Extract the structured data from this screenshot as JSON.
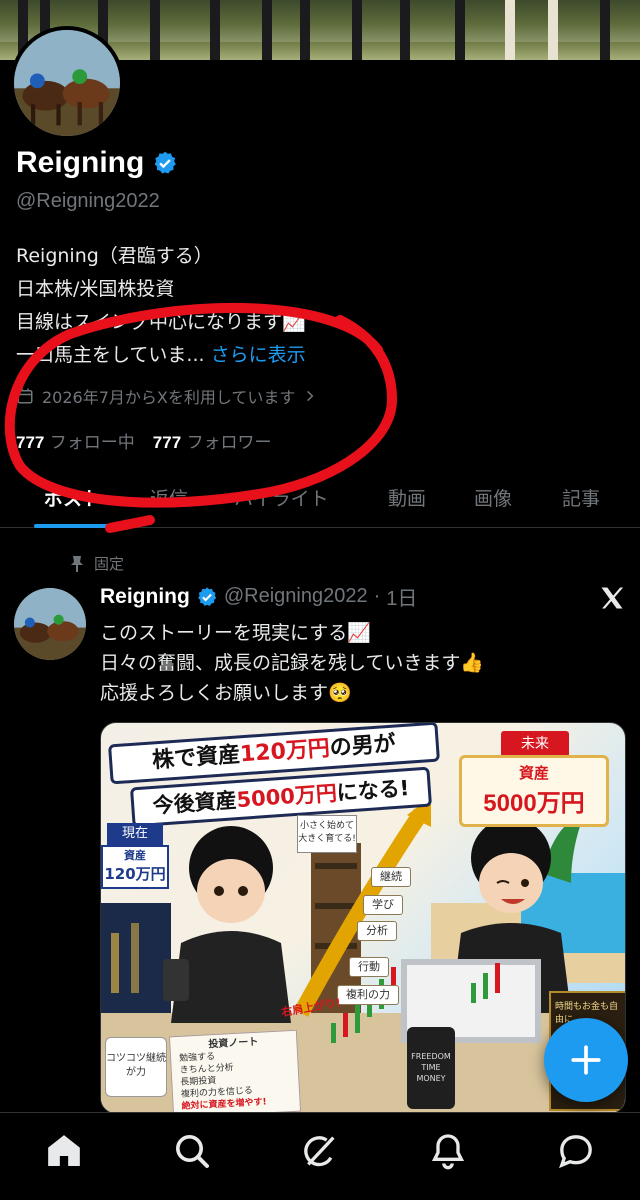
{
  "profile": {
    "name": "Reigning",
    "handle": "@Reigning2022",
    "bio_lines": [
      "Reigning（君臨する）",
      "日本株/米国株投資",
      "目線はスイング中心になります📈",
      "一口馬主をしていま..."
    ],
    "bio_more": "さらに表示",
    "joined": "2026年7月からXを利用しています",
    "following_count": "777",
    "following_label": "フォロー中",
    "followers_count": "777",
    "followers_label": "フォロワー"
  },
  "tabs": [
    "ポスト",
    "返信",
    "ハイライト",
    "動画",
    "画像",
    "記事"
  ],
  "active_tab": "ポスト",
  "post": {
    "pinned_label": "固定",
    "author_name": "Reigning",
    "author_handle": "@Reigning2022",
    "time": "1日",
    "text_lines": [
      "このストーリーを現実にする📈",
      "日々の奮闘、成長の記録を残していきます👍",
      "応援よろしくお願いします🥺"
    ],
    "image": {
      "title_line1_a": "株で資産",
      "title_line1_b": "120万円",
      "title_line1_c": "の男が",
      "title_line2_a": "今後資産",
      "title_line2_b": "5000万円",
      "title_line2_c": "になる!",
      "future_tag": "未来",
      "future_label": "資産",
      "future_value": "5000万円",
      "now_tag": "現在",
      "now_label": "資産",
      "now_value": "120万円",
      "small_note": "小さく始めて大きく育てる!",
      "steps": [
        "継続",
        "学び",
        "分析",
        "行動",
        "複利の力"
      ],
      "up_label": "右肩上がり!",
      "mug_text": "コツコツ継続が力",
      "notebook_title": "投資ノート",
      "notebook_items": [
        "勉強する",
        "きちんと分析",
        "長期投資",
        "複利の力を信じる"
      ],
      "notebook_last": "絶対に資産を増やす!",
      "cup_text": "FREEDOM TIME MONEY",
      "plate_text": "時間もお金も自由に"
    }
  },
  "colors": {
    "accent": "#1d9bf0",
    "annotation": "#e8111b",
    "muted": "#71767b"
  },
  "nav_icons": [
    "home-icon",
    "search-icon",
    "grok-icon",
    "notifications-icon",
    "messages-icon"
  ]
}
